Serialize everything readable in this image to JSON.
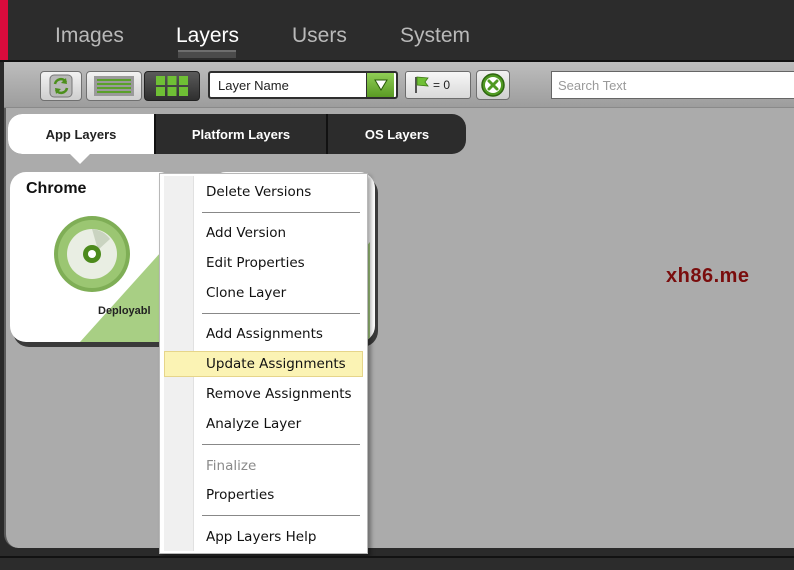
{
  "colors": {
    "brand_accent": "#d80b3c",
    "deployable_green": "#5a9a24",
    "menu_highlight": "#fbf3b4"
  },
  "nav": {
    "tabs": [
      {
        "label": "Images"
      },
      {
        "label": "Layers"
      },
      {
        "label": "Users"
      },
      {
        "label": "System"
      }
    ],
    "active": "Layers"
  },
  "toolbar": {
    "refresh_icon": "refresh-icon",
    "list_view_icon": "list-view-icon",
    "grid_view_icon": "grid-view-icon",
    "sort_select": {
      "value": "Layer Name"
    },
    "flag_filter": {
      "icon": "flag-icon",
      "label": "= 0"
    },
    "clear_icon": "clear-filter-icon",
    "search": {
      "placeholder": "Search Text",
      "value": ""
    }
  },
  "category_tabs": [
    {
      "label": "App Layers"
    },
    {
      "label": "Platform Layers"
    },
    {
      "label": "OS Layers"
    }
  ],
  "cards": [
    {
      "title": "Chrome",
      "status": "Deployabl",
      "icon": "disc-icon"
    }
  ],
  "context_menu": {
    "items": [
      {
        "label": "Delete Versions"
      },
      {
        "label": "Add Version"
      },
      {
        "label": "Edit Properties"
      },
      {
        "label": "Clone Layer"
      },
      {
        "label": "Add Assignments"
      },
      {
        "label": "Update Assignments"
      },
      {
        "label": "Remove Assignments"
      },
      {
        "label": "Analyze Layer"
      },
      {
        "label": "Finalize"
      },
      {
        "label": "Properties"
      },
      {
        "label": "App Layers Help"
      }
    ],
    "highlighted": "Update Assignments",
    "disabled": [
      "Finalize"
    ]
  },
  "watermark": "xh86.me"
}
